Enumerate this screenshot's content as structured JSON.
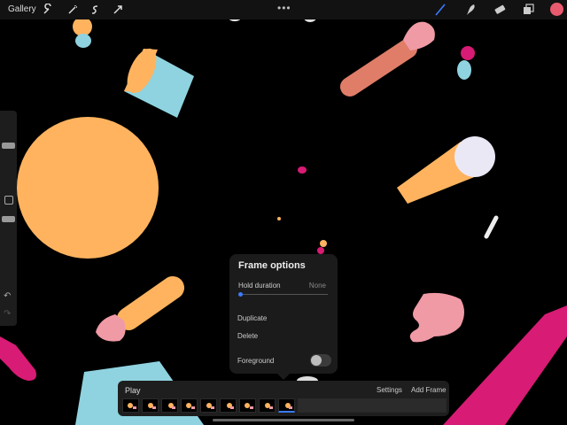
{
  "topbar": {
    "gallery_label": "Gallery",
    "left_tools": [
      "wrench-icon",
      "magic-wand-icon",
      "selection-icon",
      "transform-icon"
    ],
    "right_tools": [
      "brush-icon",
      "smudge-icon",
      "eraser-icon",
      "layers-icon"
    ],
    "active_tool": "brush-icon",
    "current_color": "#e85a6e"
  },
  "popover": {
    "title": "Frame options",
    "hold_duration_label": "Hold duration",
    "hold_duration_value": "None",
    "duplicate_label": "Duplicate",
    "delete_label": "Delete",
    "foreground_label": "Foreground",
    "hold_duration_level": 0,
    "foreground_enabled": false
  },
  "timeline": {
    "play_label": "Play",
    "settings_label": "Settings",
    "add_frame_label": "Add Frame"
  },
  "colors": {
    "orange": "#ffb35e",
    "teal": "#8fd3e0",
    "salmon": "#e07d68",
    "pink": "#f09aa6",
    "magenta": "#d81b74",
    "lavender": "#ebe8f5",
    "accent": "#3a7bff"
  }
}
